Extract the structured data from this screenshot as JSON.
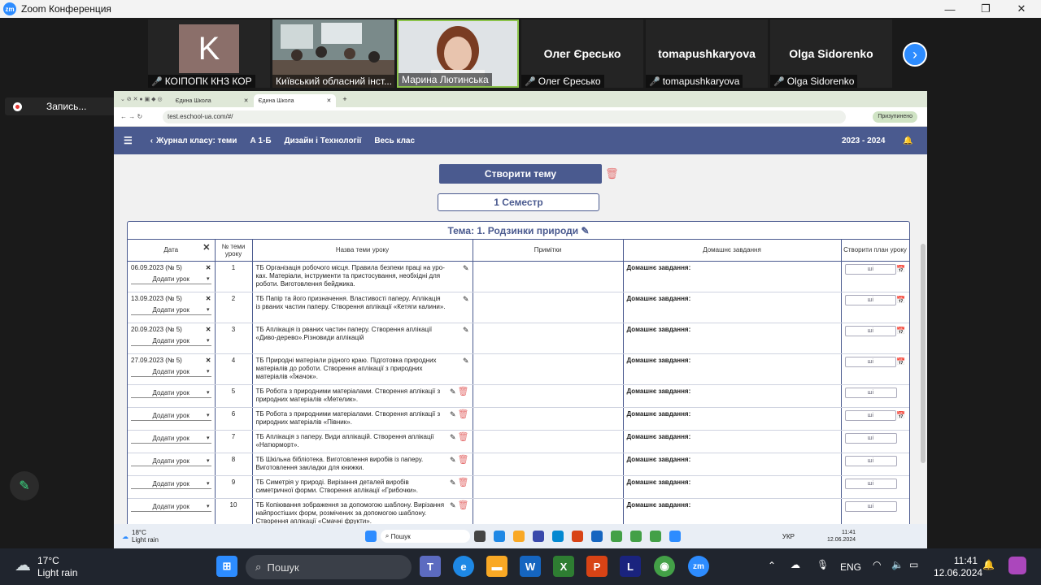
{
  "zoom": {
    "window_title": "Zoom Конференция",
    "logo": "zm",
    "participants": [
      {
        "label": "КОІПОПК КНЗ КОР",
        "initial": "K",
        "muted": true
      },
      {
        "label": "Київський обласний інст...",
        "muted": false
      },
      {
        "label": "Марина Лютинська",
        "muted": false
      },
      {
        "label": "Олег Єресько",
        "big_name": "Олег Єресько",
        "muted": true
      },
      {
        "label": "tomapushkaryova",
        "big_name": "tomapushkaryova",
        "muted": true
      },
      {
        "label": "Olga Sidorenko",
        "big_name": "Olga Sidorenko",
        "muted": true
      }
    ],
    "recording_label": "Запись..."
  },
  "browser": {
    "tabs": [
      "Єдина Школа",
      "Єдина Школа"
    ],
    "url": "test.eschool-ua.com/#/",
    "paused_label": "Призупинено"
  },
  "app": {
    "breadcrumb": "Журнал класу: теми",
    "class_name": "А 1-Б",
    "subject": "Дизайн і Технології",
    "scope": "Весь клас",
    "year": "2023 - 2024",
    "create_topic_label": "Створити тему",
    "semester_label": "1 Семестр",
    "topic_title": "Тема: 1. Родзинки природи",
    "columns": {
      "date": "Дата",
      "num": "№ теми уроку",
      "title": "Назва теми уроку",
      "notes": "Примітки",
      "homework": "Домашнє завдання",
      "plan": "Створити план уроку"
    },
    "add_lesson_label": "Додати урок",
    "homework_label": "Домашнє завдання:",
    "plan_placeholder": "ші",
    "rows": [
      {
        "date": "06.09.2023 (№ 5)",
        "num": "1",
        "title": "ТБ Організація робочого місця. Правила безпеки праці на уро- ках. Матеріали, інструменти та пристосування, необхідні для роботи. Виготовлення бейджика."
      },
      {
        "date": "13.09.2023 (№ 5)",
        "num": "2",
        "title": "ТБ Папір та його призначення. Властивості паперу. Аплікація із рваних частин паперу. Створення аплікації «Кетяги калини»."
      },
      {
        "date": "20.09.2023 (№ 5)",
        "num": "3",
        "title": "ТБ Аплікація із рваних частин паперу. Створення аплікації «Диво-дерево».Різновиди аплікацій"
      },
      {
        "date": "27.09.2023 (№ 5)",
        "num": "4",
        "title": "ТБ Природні матеріали рідного краю. Підготовка природних матеріалів до роботи. Створення аплікації з природних матеріалів «Їжачок»."
      },
      {
        "date": "",
        "num": "5",
        "title": "ТБ Робота з природними матеріалами. Створення аплікації з природних матеріалів «Метелик»."
      },
      {
        "date": "",
        "num": "6",
        "title": "ТБ Робота з природними матеріалами. Створення аплікації з природних матеріалів «Півник»."
      },
      {
        "date": "",
        "num": "7",
        "title": "ТБ Аплікація з паперу. Види аплікацій. Створення аплікації «Натюрморт»."
      },
      {
        "date": "",
        "num": "8",
        "title": "ТБ Шкільна бібліотека. Виготовлення виробів із паперу. Виготовлення закладки для книжки."
      },
      {
        "date": "",
        "num": "9",
        "title": "ТБ Симетрія у природі. Вирізання деталей виробів симетричної форми. Створення аплікації «Грибочки»."
      },
      {
        "date": "",
        "num": "10",
        "title": "ТБ Копіювання зображення за допомогою шаблону. Вирізання найпростіших форм, розмічених за допомогою шаблону. Створення аплікації «Смачні фрукти»."
      }
    ]
  },
  "inner_taskbar": {
    "weather_temp": "18°C",
    "weather_desc": "Light rain",
    "search": "Пошук",
    "lang": "УКР",
    "time": "11:41",
    "date": "12.06.2024"
  },
  "taskbar": {
    "weather_temp": "17°C",
    "weather_desc": "Light rain",
    "search": "Пошук",
    "lang": "ENG",
    "time": "11:41",
    "date": "12.06.2024"
  }
}
